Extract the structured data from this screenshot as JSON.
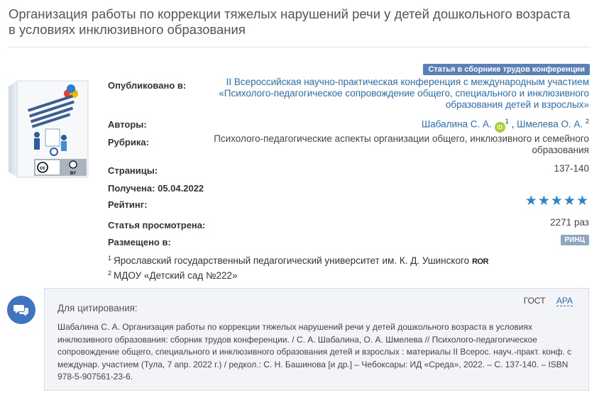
{
  "title": "Организация работы по коррекции тяжелых нарушений речи у детей дошкольного возраста в условиях инклюзивного образования",
  "publication_type": "Статья в сборнике трудов конференции",
  "cover": {
    "license_label": "BY",
    "cover_text": "Психолого-педагогическое сопровождение общего, специального и инклюзивного образования детей и взрослых"
  },
  "fields": {
    "published_in_label": "Опубликовано в:",
    "published_in_value": "II Всероссийская научно-практическая конференция с международным участием «Психолого-педагогическое сопровождение общего, специального и инклюзивного образования детей и взрослых»",
    "authors_label": "Авторы:",
    "authors": [
      {
        "name": "Шабалина С. А.",
        "sup": "1",
        "orcid": true
      },
      {
        "name": "Шмелева О. А.",
        "sup": "2",
        "orcid": false
      }
    ],
    "orcid_glyph": "iD",
    "rubric_label": "Рубрика:",
    "rubric_value": "Психолого-педагогические аспекты организации общего, инклюзивного и семейного образования",
    "pages_label": "Страницы:",
    "pages_value": "137-140",
    "received_label": "Получена:",
    "received_value": "05.04.2022",
    "rating_label": "Рейтинг:",
    "rating_value": 5,
    "rating_max": 5,
    "views_label": "Статья просмотрена:",
    "views_value": "2271 раз",
    "indexed_label": "Размещено в:",
    "indexed_badge": "РИНЦ"
  },
  "affiliations": [
    {
      "sup": "1",
      "text": "Ярославский государственный педагогический университет им. К. Д. Ушинского",
      "ror": "ROR"
    },
    {
      "sup": "2",
      "text": "МДОУ «Детский сад №222»",
      "ror": ""
    }
  ],
  "citation": {
    "heading": "Для цитирования:",
    "tabs": [
      "ГОСТ",
      "APA"
    ],
    "active_tab": "APA",
    "text": "Шабалина С. А. Организация работы по коррекции тяжелых нарушений речи у детей дошкольного возраста в условиях инклюзивного образования: сборник трудов конференции. / С. А. Шабалина, О. А. Шмелева // Психолого-педагогическое сопровождение общего, специального и инклюзивного образования детей и взрослых : материалы II Всерос. науч.-практ. конф. с междунар. участием (Тула, 7 апр. 2022 г.) / редкол.: С. Н. Башинова [и др.] – Чебоксары: ИД «Среда», 2022. – С. 137-140. – ISBN 978-5-907561-23-6."
  },
  "colors": {
    "link": "#2a6db5",
    "badge": "#5b80b7",
    "star": "#2a85c9",
    "orcid": "#a6ce39",
    "chat": "#3e74c0"
  },
  "icons": {
    "chat": "chat-bubbles-icon",
    "star": "star-icon",
    "orcid": "orcid-icon"
  }
}
